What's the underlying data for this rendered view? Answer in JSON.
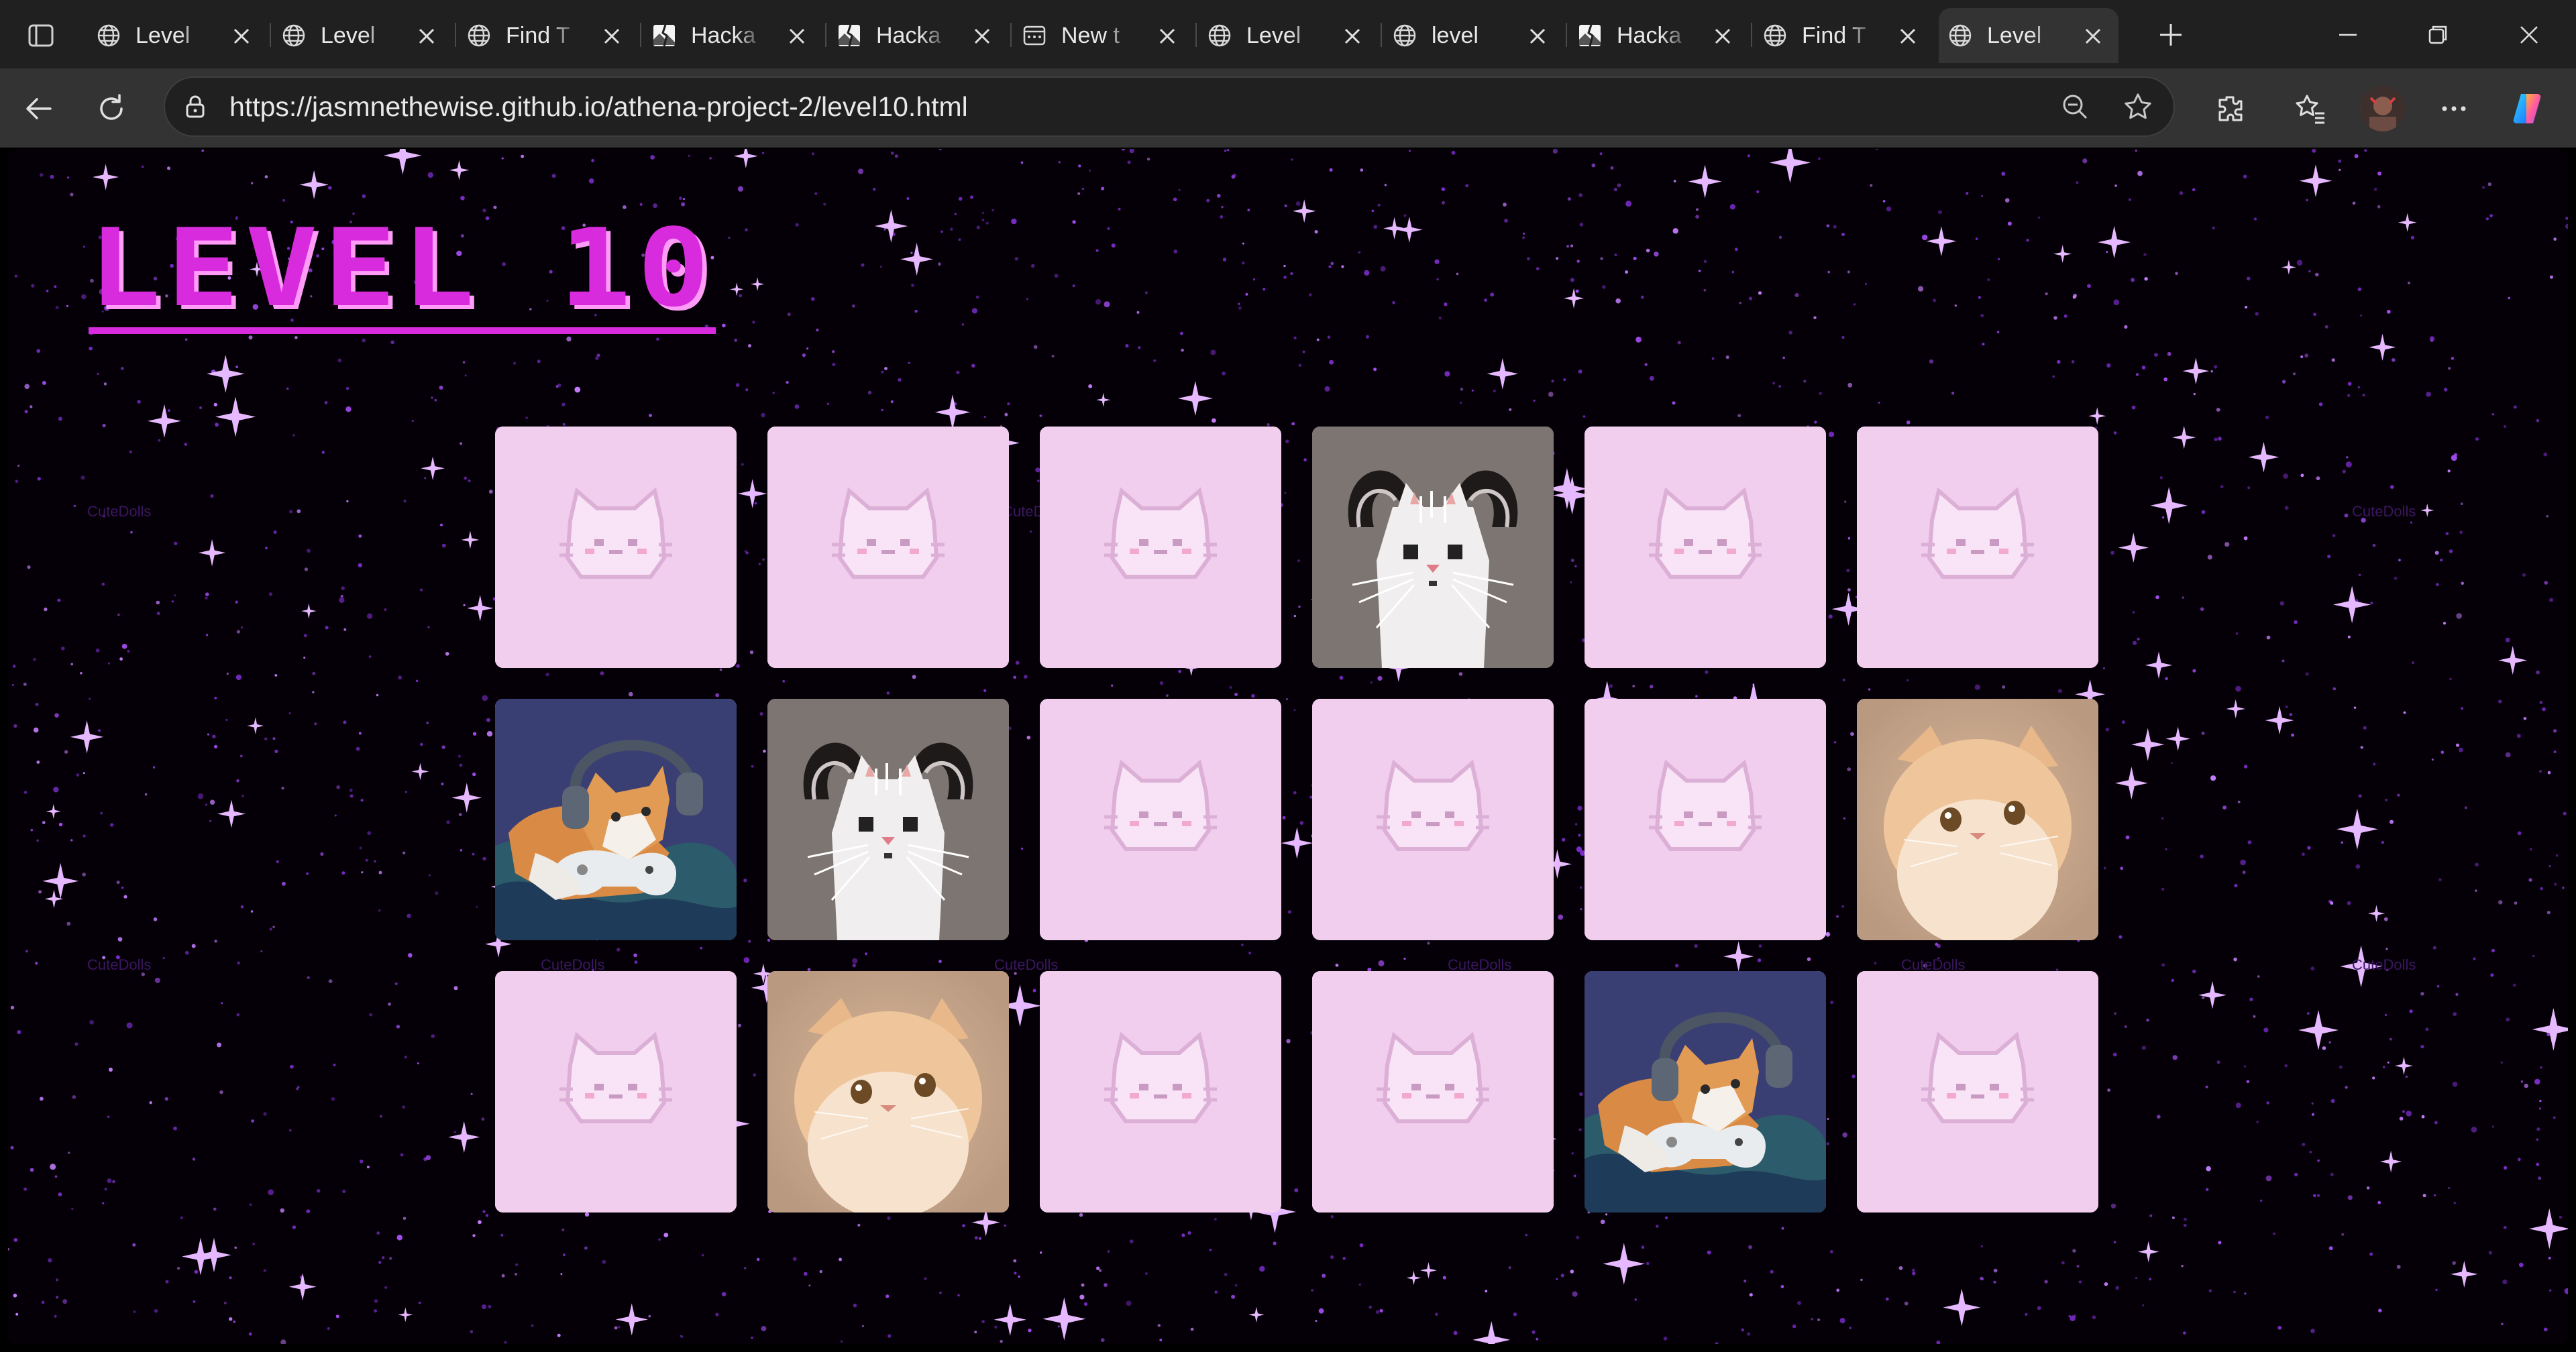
{
  "browser": {
    "tabs": [
      {
        "label": "Level ",
        "icon": "globe-icon"
      },
      {
        "label": "Level ",
        "icon": "globe-icon"
      },
      {
        "label": "Find T",
        "icon": "globe-icon"
      },
      {
        "label": "Hacka",
        "icon": "broken-image-icon"
      },
      {
        "label": "Hacka",
        "icon": "broken-image-icon"
      },
      {
        "label": "New t",
        "icon": "new-tab-icon"
      },
      {
        "label": "Level ",
        "icon": "globe-icon"
      },
      {
        "label": "level ",
        "icon": "globe-icon"
      },
      {
        "label": "Hacka",
        "icon": "broken-image-icon"
      },
      {
        "label": "Find T",
        "icon": "globe-icon"
      },
      {
        "label": "Level",
        "icon": "globe-icon",
        "active": true
      }
    ],
    "url": "https://jasmnethewise.github.io/athena-project-2/level10.html"
  },
  "page": {
    "title": "LEVEL 10",
    "watermark_text": "CuteDolls",
    "colors": {
      "title": "#d92bde",
      "card_back": "#f1cdee",
      "background": "#000000"
    },
    "cards": [
      {
        "state": "face-down",
        "image": "pixel-cat-back"
      },
      {
        "state": "face-down",
        "image": "pixel-cat-back"
      },
      {
        "state": "face-down",
        "image": "pixel-cat-back"
      },
      {
        "state": "face-up",
        "image": "pixel-cat-horns"
      },
      {
        "state": "face-down",
        "image": "pixel-cat-back"
      },
      {
        "state": "face-down",
        "image": "pixel-cat-back"
      },
      {
        "state": "face-up",
        "image": "gamer-cat-headphones"
      },
      {
        "state": "face-up",
        "image": "pixel-cat-horns"
      },
      {
        "state": "face-down",
        "image": "pixel-cat-back"
      },
      {
        "state": "face-down",
        "image": "pixel-cat-back"
      },
      {
        "state": "face-down",
        "image": "pixel-cat-back"
      },
      {
        "state": "face-up",
        "image": "fluffy-orange-cat"
      },
      {
        "state": "face-down",
        "image": "pixel-cat-back"
      },
      {
        "state": "face-up",
        "image": "fluffy-orange-cat"
      },
      {
        "state": "face-down",
        "image": "pixel-cat-back"
      },
      {
        "state": "face-down",
        "image": "pixel-cat-back"
      },
      {
        "state": "face-up",
        "image": "gamer-cat-headphones"
      },
      {
        "state": "face-down",
        "image": "pixel-cat-back"
      }
    ]
  }
}
